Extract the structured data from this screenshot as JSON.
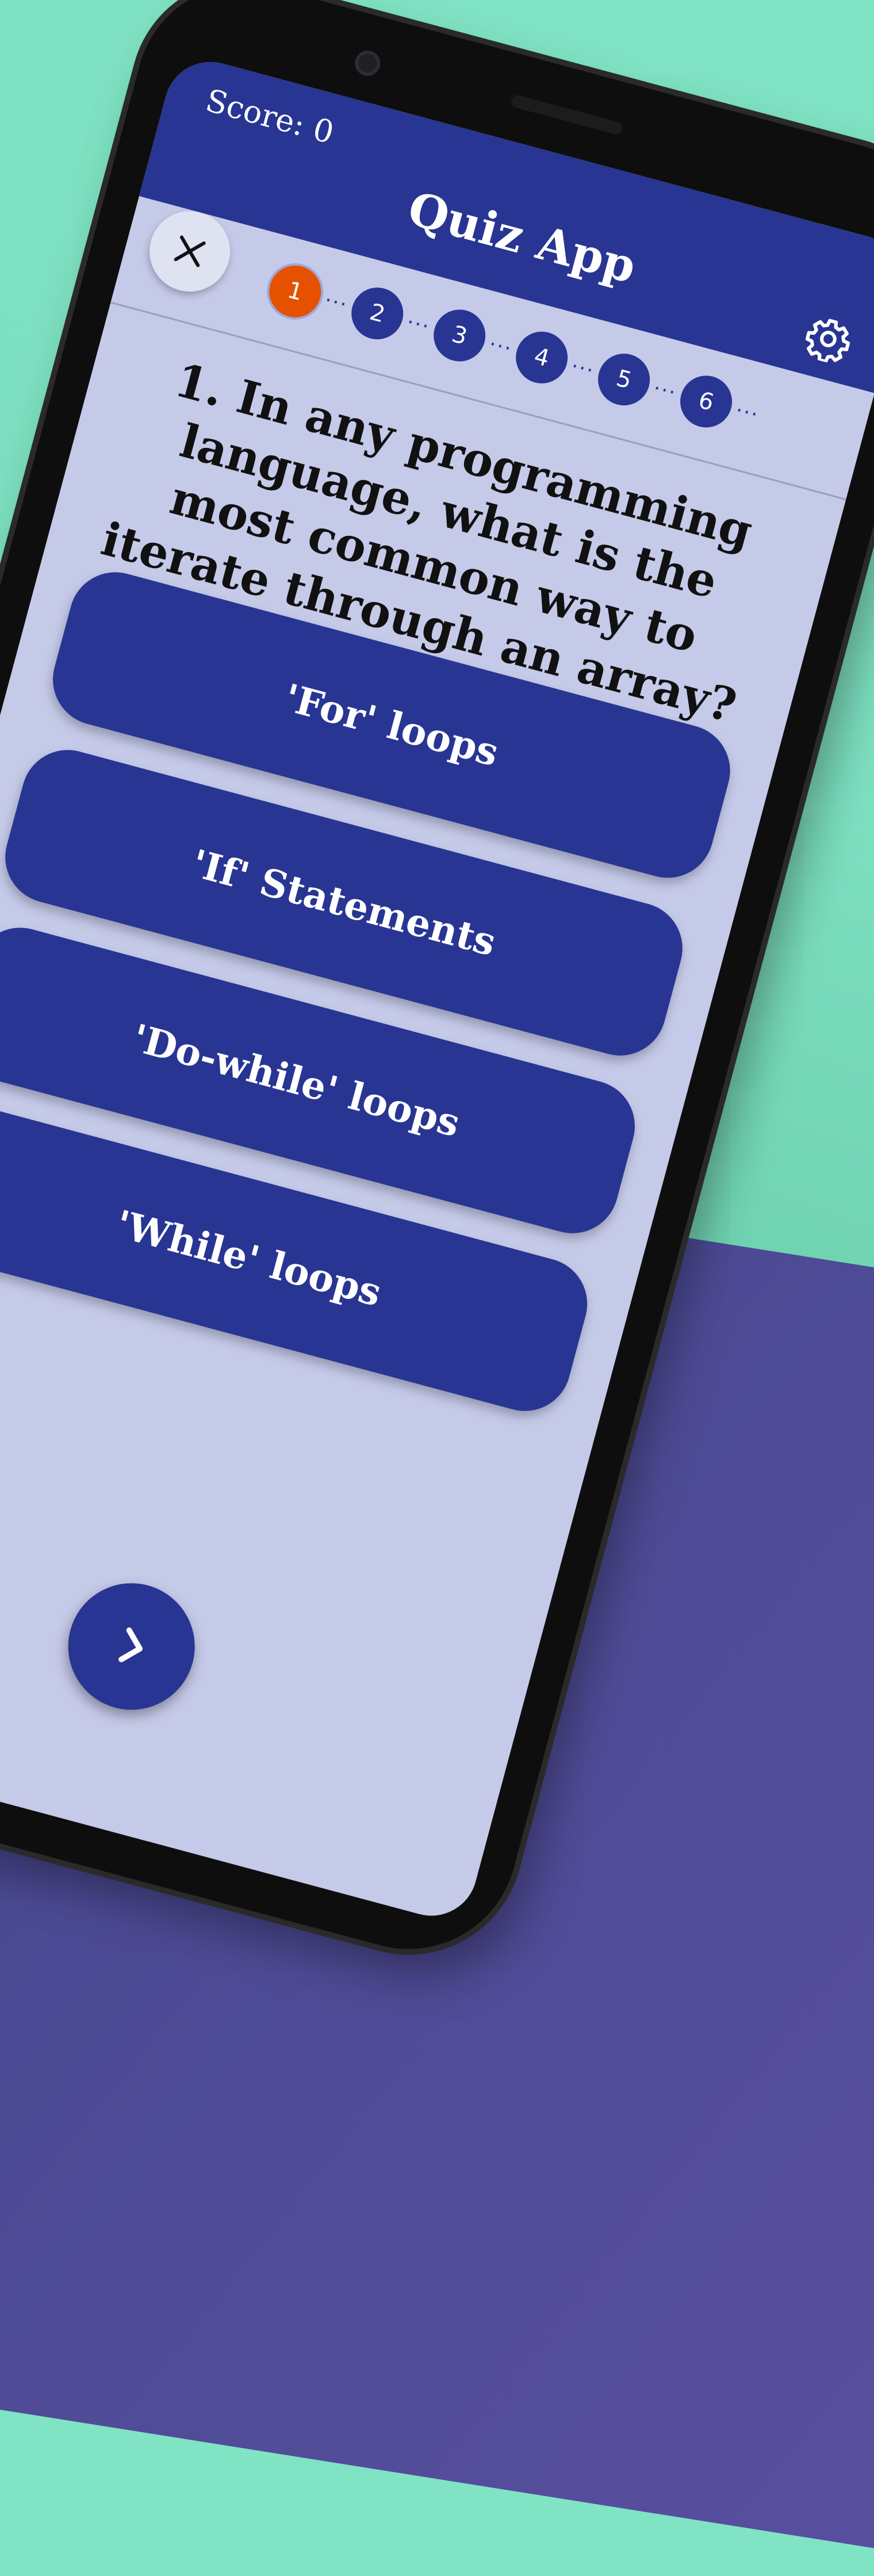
{
  "header": {
    "score_label": "Score: 0",
    "title": "Quiz App",
    "settings_icon": "gear-icon",
    "close_icon": "close-icon"
  },
  "progress": {
    "steps": [
      "1",
      "2",
      "3",
      "4",
      "5",
      "6"
    ],
    "current": 1
  },
  "question": {
    "number": "1.",
    "text": "In any programming language, what is the most common way to iterate through an array?"
  },
  "answers": [
    "'For' loops",
    "'If' Statements",
    "'Do-while' loops",
    "'While' loops"
  ],
  "navigation": {
    "prev_icon": "chevron-left-icon",
    "next_icon": "chevron-right-icon"
  },
  "colors": {
    "primary": "#283593",
    "active_step": "#e65100",
    "screen_bg": "#c5cae9",
    "background_green": "#7fe3c4",
    "background_purple": "#4c4a94"
  }
}
